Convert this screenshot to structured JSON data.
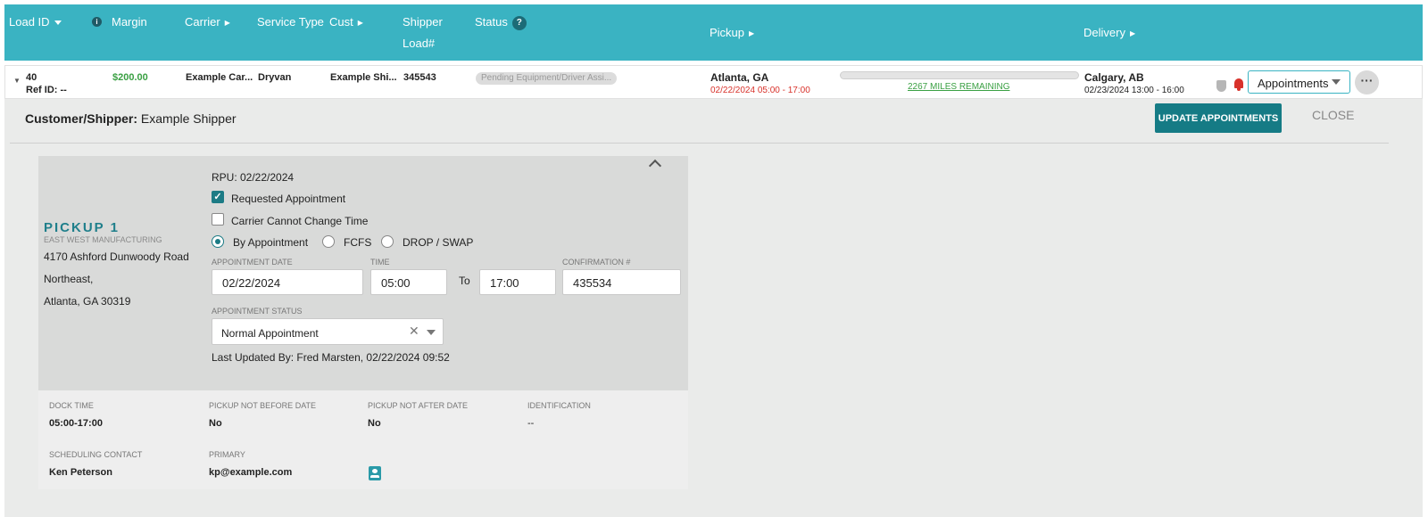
{
  "header": {
    "load_id": "Load ID",
    "margin": "Margin",
    "carrier": "Carrier",
    "service_type": "Service Type",
    "cust": "Cust",
    "shipper": "Shipper",
    "shipper_load": "Load#",
    "status": "Status",
    "status_help": "?",
    "pickup": "Pickup",
    "delivery": "Delivery"
  },
  "row": {
    "load_id": "40",
    "ref_id": "Ref ID: --",
    "margin": "$200.00",
    "carrier": "Example Car...",
    "service_type": "Dryvan",
    "cust": "Example Shi...",
    "shipper_load": "345543",
    "status": "Pending Equipment/Driver Assi...",
    "pickup_city": "Atlanta, GA",
    "pickup_window": "02/22/2024 05:00 - 17:00",
    "miles_remaining": "2267 MILES REMAINING",
    "progress_fraction": 0.0,
    "delivery_city": "Calgary, AB",
    "delivery_window": "02/23/2024 13:00 - 16:00",
    "view_select": "Appointments",
    "more": "···"
  },
  "panel": {
    "customer_label": "Customer/Shipper:",
    "customer_value": "Example Shipper",
    "update_button": "UPDATE APPOINTMENTS",
    "close_button": "CLOSE"
  },
  "stop": {
    "title": "PICKUP 1",
    "company": "EAST WEST MANUFACTURING",
    "address_line1": "4170 Ashford Dunwoody Road",
    "address_line2": "Northeast,",
    "address_line3": "Atlanta, GA 30319",
    "rpu": "RPU: 02/22/2024",
    "requested_appointment": "Requested Appointment",
    "requested_checked": true,
    "carrier_cannot_change": "Carrier Cannot Change Time",
    "carrier_cannot_checked": false,
    "mode_options": [
      "By Appointment",
      "FCFS",
      "DROP / SWAP"
    ],
    "mode_selected": "By Appointment",
    "appt_date_label": "APPOINTMENT DATE",
    "appt_date": "02/22/2024",
    "time_label": "TIME",
    "time_from": "05:00",
    "to_label": "To",
    "time_to": "17:00",
    "confirmation_label": "CONFIRMATION #",
    "confirmation": "435534",
    "appt_status_label": "APPOINTMENT STATUS",
    "appt_status": "Normal Appointment",
    "last_updated": "Last Updated By: Fred Marsten, 02/22/2024 09:52"
  },
  "details": {
    "dock_time_label": "DOCK TIME",
    "dock_time": "05:00-17:00",
    "not_before_label": "PICKUP NOT BEFORE DATE",
    "not_before": "No",
    "not_after_label": "PICKUP NOT AFTER DATE",
    "not_after": "No",
    "identification_label": "IDENTIFICATION",
    "identification": "--",
    "scheduling_label": "SCHEDULING CONTACT",
    "scheduling": "Ken Peterson",
    "primary_label": "PRIMARY",
    "primary": "kp@example.com"
  },
  "colors": {
    "header_bg": "#3ab3c2",
    "accent_dark": "#157b85",
    "money_green": "#3aa043",
    "alert_red": "#d8322b"
  }
}
